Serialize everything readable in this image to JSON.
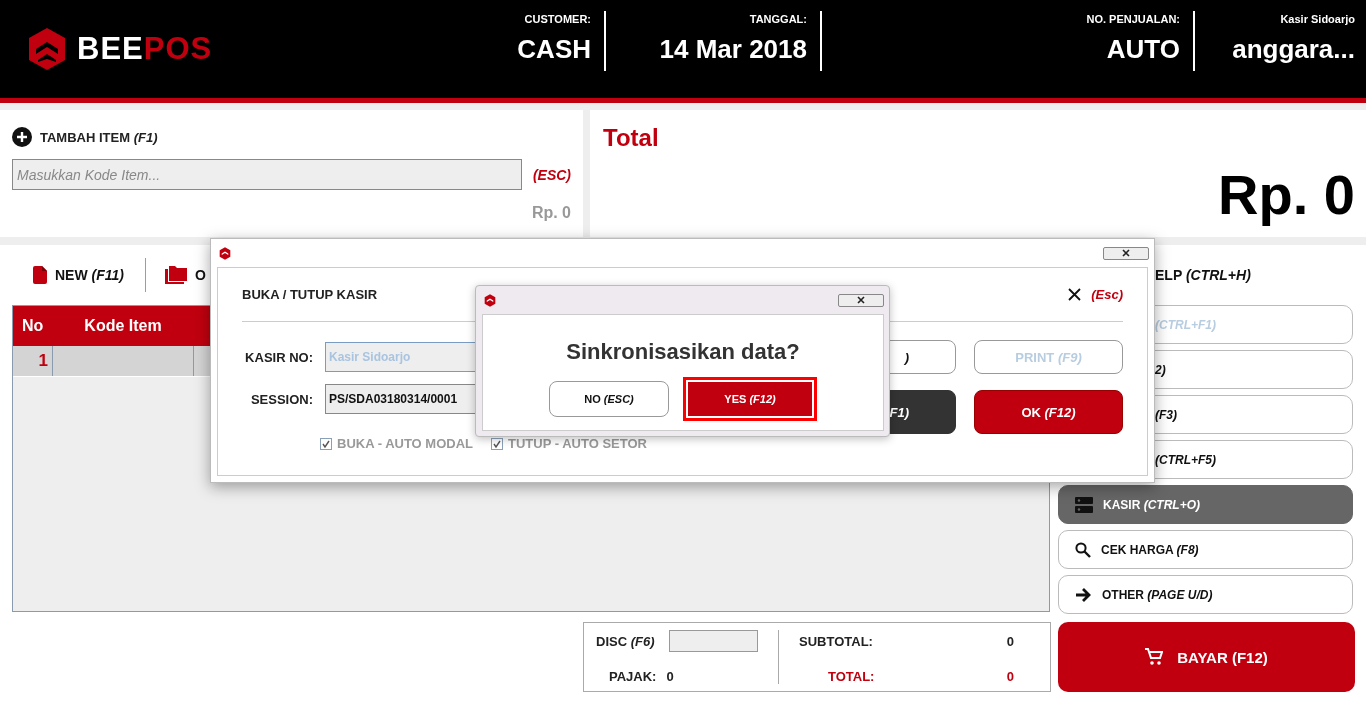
{
  "header": {
    "logo": {
      "part_1": "BEE",
      "part_2": "POS"
    },
    "fields": [
      {
        "label": "CUSTOMER:",
        "value": "CASH"
      },
      {
        "label": "TANGGAL:",
        "value": "14 Mar 2018"
      },
      {
        "label": "NO. PENJUALAN:",
        "value": "AUTO"
      },
      {
        "label": "Kasir Sidoarjo",
        "value": "anggara..."
      }
    ]
  },
  "add_item": {
    "title": "TAMBAH ITEM *(F1)*",
    "placeholder": "Masukkan Kode Item...",
    "escape": "(ESC)",
    "price": "Rp. 0"
  },
  "total": {
    "title": "Total",
    "amount": "Rp. 0"
  },
  "toolbar": [
    {
      "label": "NEW *(F11)*",
      "kind": "file"
    },
    {
      "label": "O",
      "kind": "folder"
    }
  ],
  "table": {
    "columns": [
      "No",
      "Kode Item"
    ],
    "rows": [
      {
        "no": "1",
        "selected": true
      }
    ]
  },
  "summary": {
    "disc_label": "DISC *(F6)*",
    "pajak_label": "PAJAK:",
    "pajak_value": "0",
    "subtotal_label": "SUBTOTAL:",
    "subtotal_value": "0",
    "total_label": "TOTAL:",
    "total_value": "0"
  },
  "sidebar": {
    "help": "ELP *(CTRL+H)*",
    "buttons": [
      {
        "label": "*(CTRL+F1)*",
        "kind": "covered",
        "disabled": true,
        "selected": false
      },
      {
        "label": "*2)*",
        "kind": "covered",
        "disabled": false,
        "selected": false
      },
      {
        "label": "*(F3)*",
        "kind": "covered",
        "disabled": false,
        "selected": false
      },
      {
        "label": "*(CTRL+F5)*",
        "kind": "covered",
        "disabled": false,
        "selected": false
      },
      {
        "label": "KASIR *(CTRL+O)*",
        "kind": "server",
        "disabled": false,
        "selected": true
      },
      {
        "label": "CEK HARGA *(F8)*",
        "kind": "search",
        "disabled": false,
        "selected": false
      },
      {
        "label": "OTHER *(PAGE U/D)*",
        "kind": "arrow",
        "disabled": false,
        "selected": false
      }
    ],
    "pay": "BAYAR (F12)"
  },
  "kasir_dialog": {
    "title": "BUKA / TUTUP KASIR",
    "close_shortcut": "(Esc)",
    "fields": [
      {
        "label": "KASIR NO:",
        "value": "Kasir Sidoarjo",
        "disabled": true
      },
      {
        "label": "SESSION:",
        "value": "PS/SDA03180314/0001",
        "disabled": false
      }
    ],
    "checkboxes": [
      {
        "label": "BUKA - AUTO MODAL",
        "checked": true
      },
      {
        "label": "TUTUP - AUTO SETOR",
        "checked": true
      }
    ],
    "buttons": [
      {
        "label": "*)*",
        "kind": "outline",
        "disabled": false
      },
      {
        "label": "PRINT *(F9)*",
        "kind": "outline",
        "disabled": true
      },
      {
        "label": "*F1)*",
        "kind": "dark",
        "disabled": false
      },
      {
        "label": "OK *(F12)*",
        "kind": "primary",
        "disabled": false
      }
    ]
  },
  "sync_dialog": {
    "question": "Sinkronisasikan data?",
    "buttons": [
      {
        "label": "NO *(ESC)*",
        "kind": "outline",
        "focused": false
      },
      {
        "label": "YES *(F12)*",
        "kind": "primary",
        "focused": true
      }
    ]
  }
}
